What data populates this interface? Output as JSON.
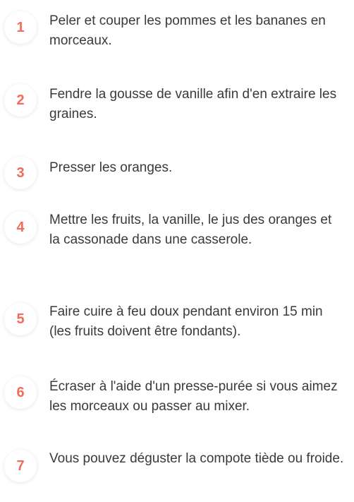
{
  "accent_color": "#f26b5b",
  "text_color": "#3a3a3a",
  "steps": [
    {
      "number": "1",
      "text": "Peler et couper les pommes et les bananes en morceaux."
    },
    {
      "number": "2",
      "text": "Fendre la gousse de vanille afin d'en extraire les graines."
    },
    {
      "number": "3",
      "text": "Presser les oranges."
    },
    {
      "number": "4",
      "text": "Mettre les fruits, la vanille, le jus des oranges et la cassonade dans une casserole."
    },
    {
      "number": "5",
      "text": "Faire cuire à feu doux pendant environ 15 min (les fruits doivent être fondants)."
    },
    {
      "number": "6",
      "text": "Écraser à l'aide d'un presse-purée si vous aimez les morceaux ou passer au mixer."
    },
    {
      "number": "7",
      "text": "Vous pouvez déguster la compote tiède ou froide."
    }
  ]
}
